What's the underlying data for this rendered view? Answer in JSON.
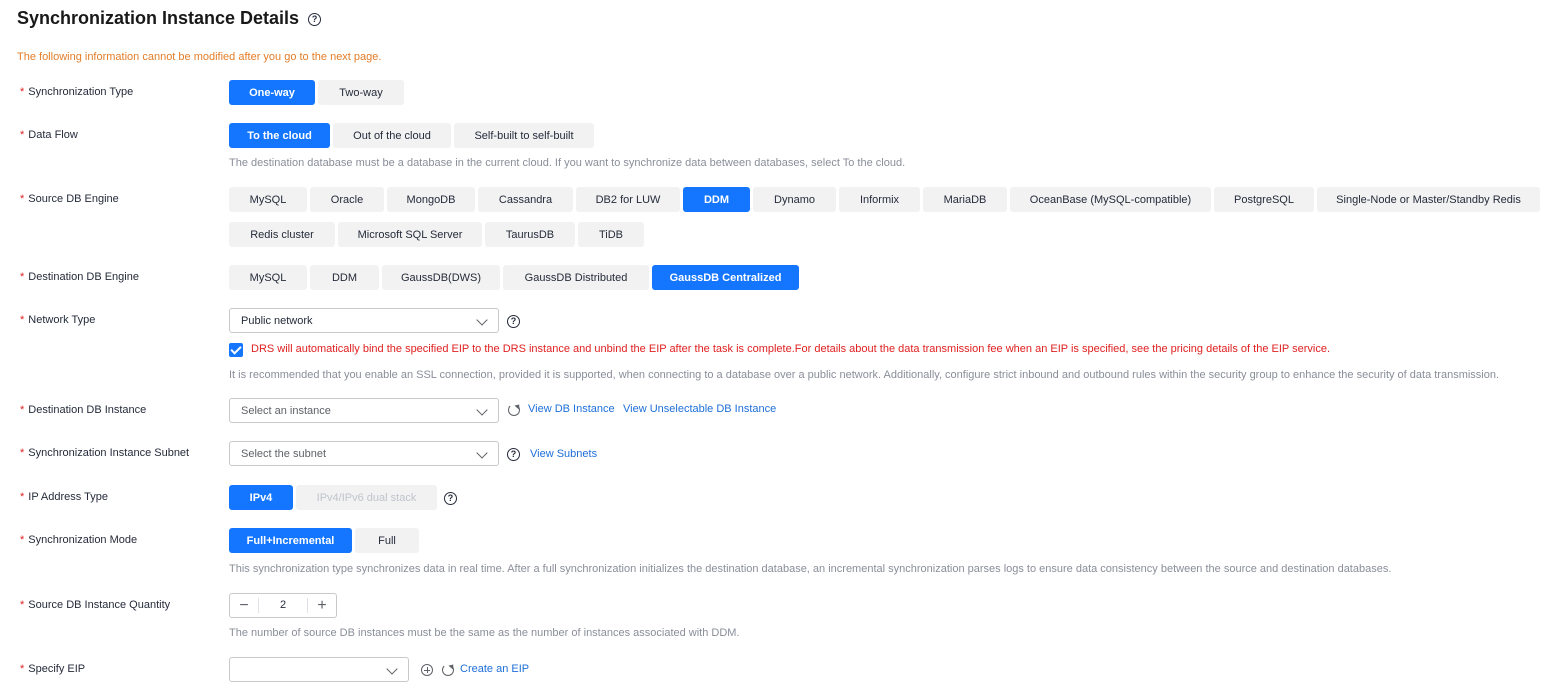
{
  "page": {
    "title": "Synchronization Instance Details",
    "warning": "The following information cannot be modified after you go to the next page."
  },
  "sync_type": {
    "label": "Synchronization Type",
    "options": [
      "One-way",
      "Two-way"
    ]
  },
  "data_flow": {
    "label": "Data Flow",
    "options": [
      "To the cloud",
      "Out of the cloud",
      "Self-built to self-built"
    ],
    "hint": "The destination database must be a database in the current cloud. If you want to synchronize data between databases, select To the cloud."
  },
  "source_engine": {
    "label": "Source DB Engine",
    "options": [
      "MySQL",
      "Oracle",
      "MongoDB",
      "Cassandra",
      "DB2 for LUW",
      "DDM",
      "Dynamo",
      "Informix",
      "MariaDB",
      "OceanBase (MySQL-compatible)",
      "PostgreSQL",
      "Single-Node or Master/Standby Redis",
      "Redis cluster",
      "Microsoft SQL Server",
      "TaurusDB",
      "TiDB"
    ]
  },
  "dest_engine": {
    "label": "Destination DB Engine",
    "options": [
      "MySQL",
      "DDM",
      "GaussDB(DWS)",
      "GaussDB Distributed",
      "GaussDB Centralized"
    ]
  },
  "network": {
    "label": "Network Type",
    "value": "Public network",
    "eip_note": "DRS will automatically bind the specified EIP to the DRS instance and unbind the EIP after the task is complete.For details about the data transmission fee when an EIP is specified, see the pricing details of the EIP service.",
    "hint": "It is recommended that you enable an SSL connection, provided it is supported, when connecting to a database over a public network. Additionally, configure strict inbound and outbound rules within the security group to enhance the security of data transmission."
  },
  "dest_instance": {
    "label": "Destination DB Instance",
    "placeholder": "Select an instance",
    "link_view": "View DB Instance",
    "link_unselectable": "View Unselectable DB Instance"
  },
  "subnet": {
    "label": "Synchronization Instance Subnet",
    "placeholder": "Select the subnet",
    "link": "View Subnets"
  },
  "ip_type": {
    "label": "IP Address Type",
    "options": [
      "IPv4",
      "IPv4/IPv6 dual stack"
    ]
  },
  "sync_mode": {
    "label": "Synchronization Mode",
    "options": [
      "Full+Incremental",
      "Full"
    ],
    "hint": "This synchronization type synchronizes data in real time. After a full synchronization initializes the destination database, an incremental synchronization parses logs to ensure data consistency between the source and destination databases."
  },
  "quantity": {
    "label": "Source DB Instance Quantity",
    "value": "2",
    "hint": "The number of source DB instances must be the same as the number of instances associated with DDM."
  },
  "eip": {
    "label": "Specify EIP",
    "link": "Create an EIP"
  },
  "icons": {
    "help": "?",
    "minus": "−",
    "plus": "+"
  },
  "colors": {
    "primary": "#1476ff",
    "warning": "#e37d29",
    "error": "#e02020",
    "link": "#1e6fd9"
  }
}
